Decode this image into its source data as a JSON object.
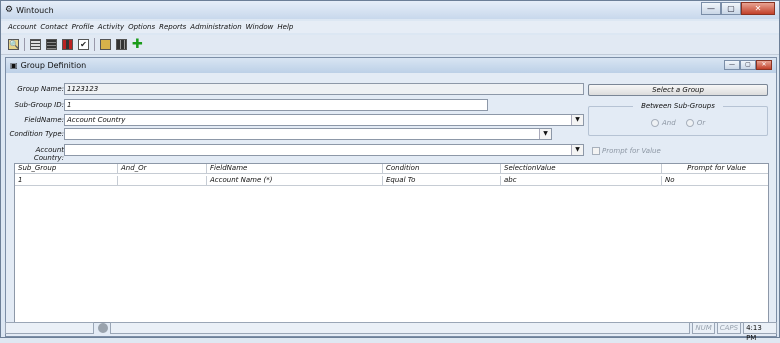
{
  "app": {
    "title": "Wintouch"
  },
  "menu": [
    "Account",
    "Contact",
    "Profile",
    "Activity",
    "Options",
    "Reports",
    "Administration",
    "Window",
    "Help"
  ],
  "toolbar": {
    "icons": [
      "find-icon",
      "list-icon",
      "list-icon",
      "chart-icon",
      "check-icon",
      "folder-icon",
      "grid-icon",
      "add-icon"
    ]
  },
  "dialog": {
    "title": "Group Definition",
    "group_name_label": "Group Name:",
    "group_name": "1123123",
    "subgroup_label": "Sub-Group ID:",
    "subgroup_id": "1",
    "fieldname_label": "FieldName:",
    "fieldname": "Account Country",
    "condition_type_label": "Condition Type:",
    "condition_type": "",
    "account_country_label": "Account Country:",
    "account_country": "",
    "select_group_button": "Select a Group",
    "between_title": "Between Sub-Groups",
    "and_label": "And",
    "or_label": "Or",
    "prompt_label": "Prompt for Value"
  },
  "grid": {
    "headers": [
      "Sub_Group",
      "And_Or",
      "FieldName",
      "Condition",
      "SelectionValue",
      "Prompt for Value"
    ],
    "rows": [
      [
        "1",
        "",
        "Account Name (*)",
        "Equal To",
        "abc",
        "No"
      ]
    ]
  },
  "status": {
    "num": "NUM",
    "caps": "CAPS",
    "time": "4:13 PM"
  }
}
